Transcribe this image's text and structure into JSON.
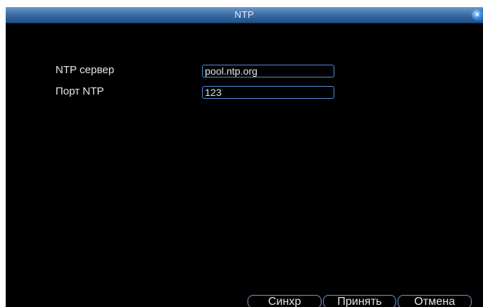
{
  "window": {
    "title": "NTP",
    "close_glyph": "×"
  },
  "form": {
    "server_label": "NTP сервер",
    "server_value": "pool.ntp.org",
    "port_label": "Порт NTP",
    "port_value": "123"
  },
  "buttons": {
    "sync_label": "Синхр",
    "apply_label": "Принять",
    "cancel_label": "Отмена"
  },
  "icons": {
    "close": "close-icon"
  },
  "colors": {
    "titlebar": "#3d6fa8",
    "accent_border": "#4c8ed8",
    "background": "#000000",
    "text": "#e6e6e6"
  }
}
